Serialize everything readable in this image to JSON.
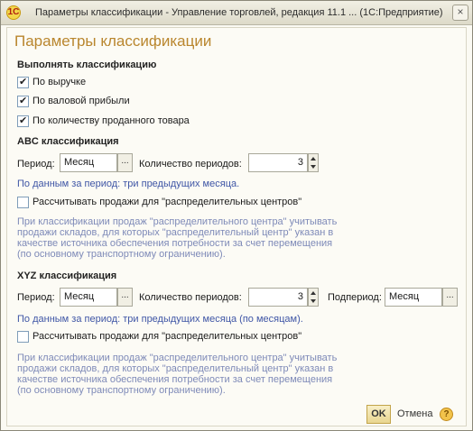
{
  "window": {
    "title": "Параметры классификации - Управление торговлей, редакция 11.1 ...   (1С:Предприятие)",
    "app_icon": "1С",
    "close_label": "×"
  },
  "form": {
    "title": "Параметры классификации"
  },
  "classify": {
    "heading": "Выполнять классификацию",
    "options": [
      {
        "label": "По выручке",
        "checked": true
      },
      {
        "label": "По валовой прибыли",
        "checked": true
      },
      {
        "label": "По количеству проданного товара",
        "checked": true
      }
    ]
  },
  "abc": {
    "heading": "ABC классификация",
    "period_label": "Период:",
    "period_value": "Месяц",
    "period_btn": "...",
    "count_label": "Количество периодов:",
    "count_value": "3",
    "note": "По данным за период: три предыдущих месяца.",
    "dc_label": "Рассчитывать продажи для \"распределительных центров\"",
    "dc_checked": false,
    "hint": "При классификации продаж \"распределительного центра\" учитывать продажи складов, для которых \"распределительный центр\" указан в качестве источника обеспечения потребности за счет перемещения (по основному транспортному ограничению)."
  },
  "xyz": {
    "heading": "XYZ классификация",
    "period_label": "Период:",
    "period_value": "Месяц",
    "period_btn": "...",
    "count_label": "Количество периодов:",
    "count_value": "3",
    "subperiod_label": "Подпериод:",
    "subperiod_value": "Месяц",
    "subperiod_btn": "...",
    "note": "По данным за период: три предыдущих месяца (по месяцам).",
    "dc_label": "Рассчитывать продажи для \"распределительных центров\"",
    "dc_checked": false,
    "hint": "При классификации продаж \"распределительного центра\" учитывать продажи складов, для которых \"распределительный центр\" указан в качестве источника обеспечения потребности за счет перемещения (по основному транспортному ограничению)."
  },
  "footer": {
    "ok_label": "OK",
    "cancel_label": "Отмена",
    "help_label": "?"
  }
}
